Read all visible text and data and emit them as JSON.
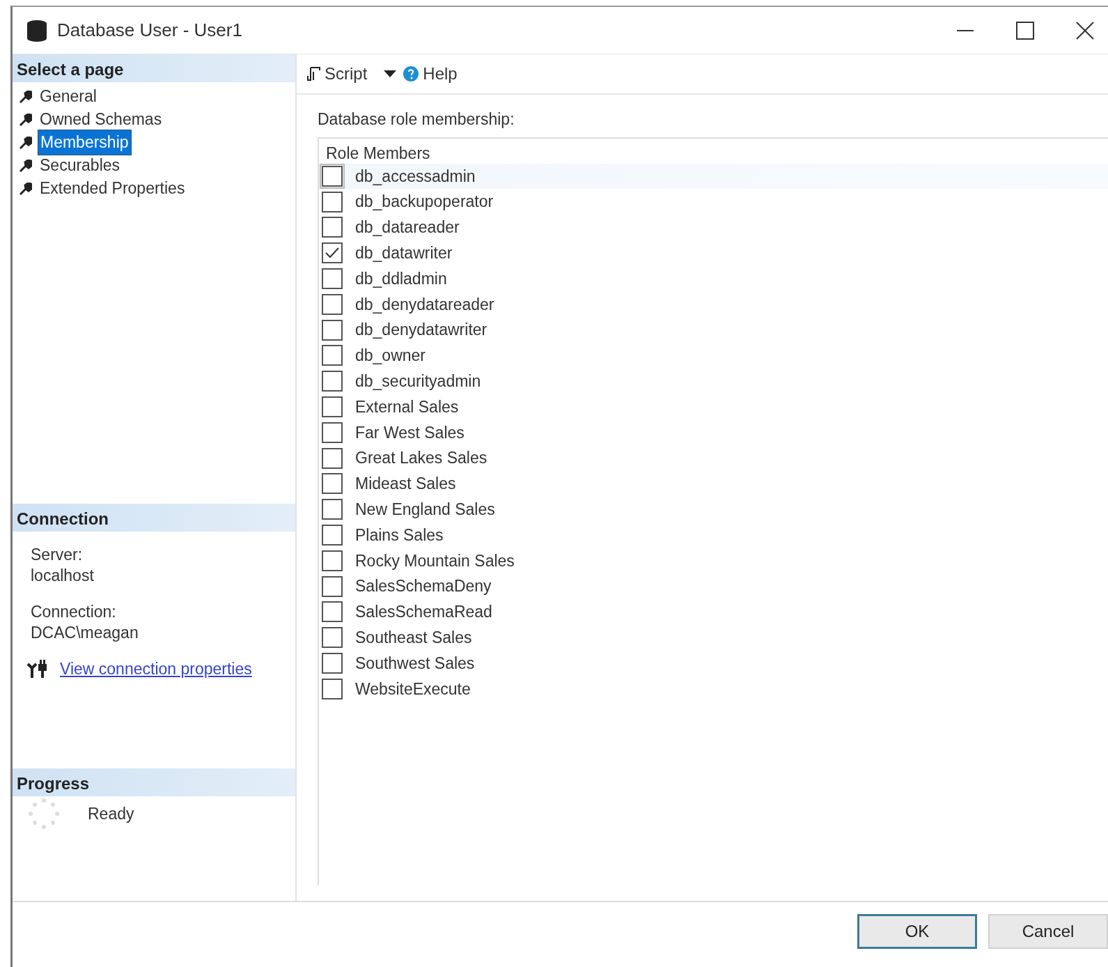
{
  "window": {
    "title": "Database User - User1"
  },
  "select_page": {
    "header": "Select a page",
    "pages": [
      {
        "label": "General",
        "selected": false
      },
      {
        "label": "Owned Schemas",
        "selected": false
      },
      {
        "label": "Membership",
        "selected": true
      },
      {
        "label": "Securables",
        "selected": false
      },
      {
        "label": "Extended Properties",
        "selected": false
      }
    ]
  },
  "connection": {
    "header": "Connection",
    "server_label": "Server:",
    "server": "localhost",
    "connection_label": "Connection:",
    "connection": "DCAC\\meagan",
    "link": "View connection properties"
  },
  "progress": {
    "header": "Progress",
    "status": "Ready"
  },
  "toolbar": {
    "script": "Script",
    "help": "Help"
  },
  "membership": {
    "label": "Database role membership:",
    "column": "Role Members",
    "roles": [
      {
        "name": "db_accessadmin",
        "checked": false,
        "selected": true
      },
      {
        "name": "db_backupoperator",
        "checked": false,
        "selected": false
      },
      {
        "name": "db_datareader",
        "checked": false,
        "selected": false
      },
      {
        "name": "db_datawriter",
        "checked": true,
        "selected": false
      },
      {
        "name": "db_ddladmin",
        "checked": false,
        "selected": false
      },
      {
        "name": "db_denydatareader",
        "checked": false,
        "selected": false
      },
      {
        "name": "db_denydatawriter",
        "checked": false,
        "selected": false
      },
      {
        "name": "db_owner",
        "checked": false,
        "selected": false
      },
      {
        "name": "db_securityadmin",
        "checked": false,
        "selected": false
      },
      {
        "name": "External Sales",
        "checked": false,
        "selected": false
      },
      {
        "name": "Far West Sales",
        "checked": false,
        "selected": false
      },
      {
        "name": "Great Lakes Sales",
        "checked": false,
        "selected": false
      },
      {
        "name": "Mideast Sales",
        "checked": false,
        "selected": false
      },
      {
        "name": "New England Sales",
        "checked": false,
        "selected": false
      },
      {
        "name": "Plains Sales",
        "checked": false,
        "selected": false
      },
      {
        "name": "Rocky Mountain Sales",
        "checked": false,
        "selected": false
      },
      {
        "name": "SalesSchemaDeny",
        "checked": false,
        "selected": false
      },
      {
        "name": "SalesSchemaRead",
        "checked": false,
        "selected": false
      },
      {
        "name": "Southeast Sales",
        "checked": false,
        "selected": false
      },
      {
        "name": "Southwest Sales",
        "checked": false,
        "selected": false
      },
      {
        "name": "WebsiteExecute",
        "checked": false,
        "selected": false
      }
    ]
  },
  "buttons": [
    {
      "label": "OK",
      "default": true
    },
    {
      "label": "Cancel",
      "default": false
    }
  ]
}
